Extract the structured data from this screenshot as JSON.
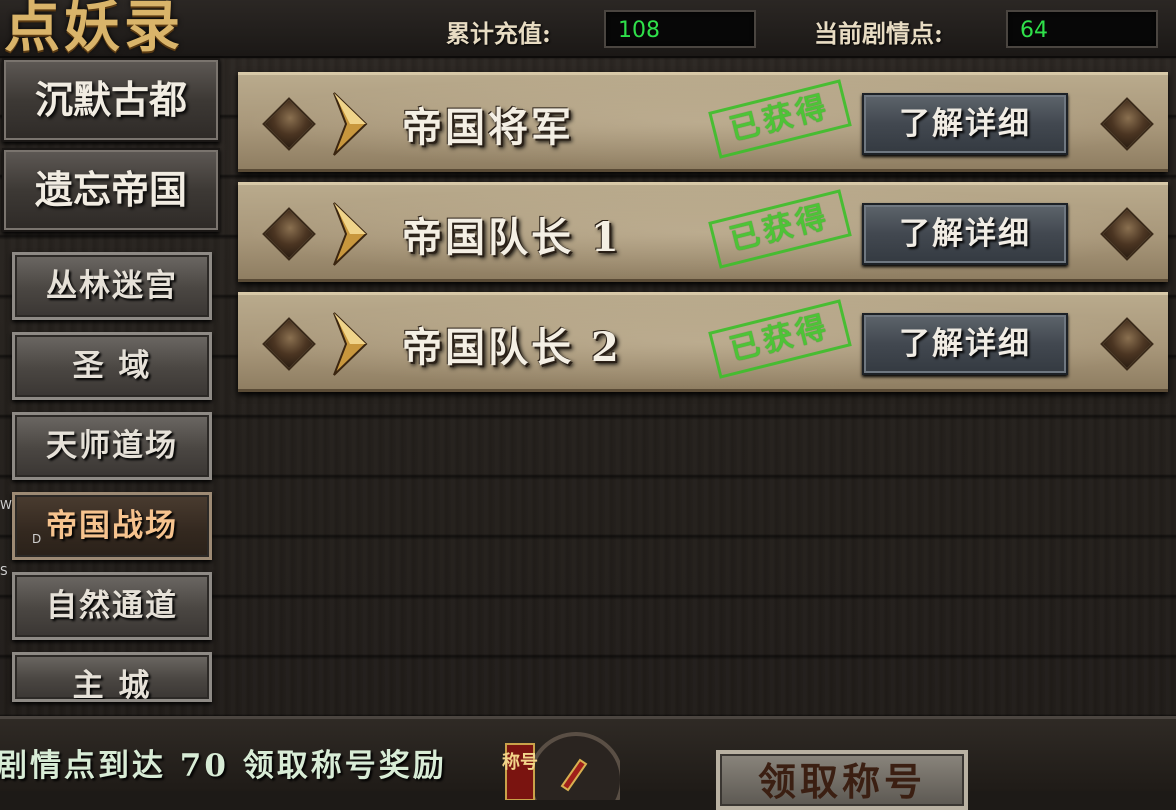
{
  "header": {
    "logo_text": "点妖录",
    "recharge_label": "累计充值:",
    "recharge_value": "108",
    "story_points_label": "当前剧情点:",
    "story_points_value": "64"
  },
  "sidebar": {
    "top_buttons": [
      "沉默古都",
      "遗忘帝国"
    ],
    "items": [
      {
        "label": "丛林迷宫",
        "active": false
      },
      {
        "label": "圣  域",
        "active": false
      },
      {
        "label": "天师道场",
        "active": false
      },
      {
        "label": "帝国战场",
        "active": true
      },
      {
        "label": "自然通道",
        "active": false
      },
      {
        "label": "主  城",
        "active": false
      }
    ]
  },
  "rows": [
    {
      "title": "帝国将军",
      "status": "已获得",
      "button": "了解详细"
    },
    {
      "title": "帝国队长 1",
      "status": "已获得",
      "button": "了解详细"
    },
    {
      "title": "帝国队长 2",
      "status": "已获得",
      "button": "了解详细"
    }
  ],
  "footer": {
    "message": "剧情点到达 70 领取称号奖励",
    "emblem_label": "称号",
    "claim_button": "领取称号"
  },
  "stray_letters": [
    "W",
    "D",
    "S"
  ],
  "colors": {
    "value_green": "#2fe04a",
    "stamp_green": "#45c630",
    "active_text": "#f6c38e",
    "logo_gold": "#d9b46a"
  }
}
